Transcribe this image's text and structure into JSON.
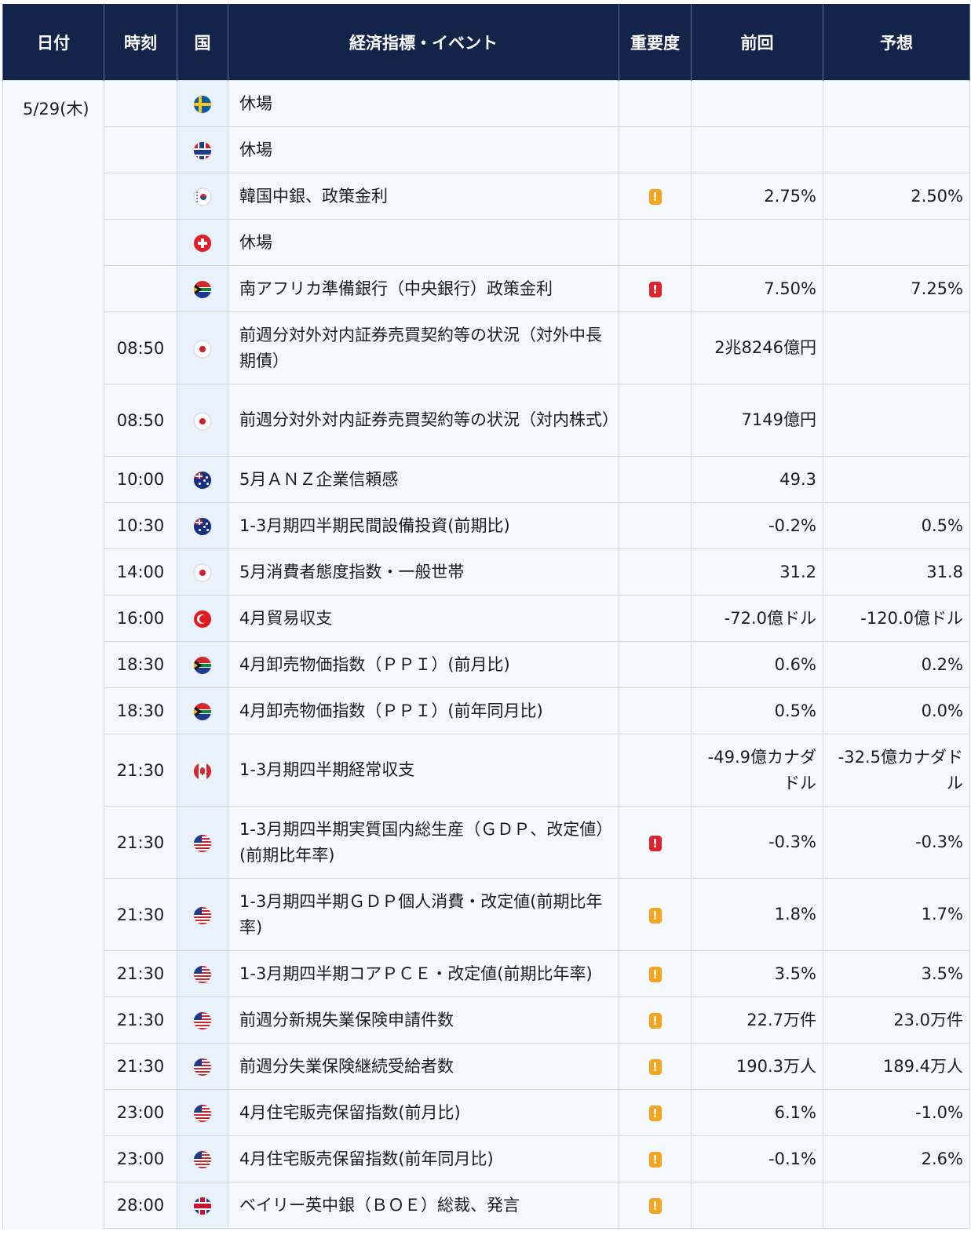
{
  "headers": {
    "date": "日付",
    "time": "時刻",
    "country": "国",
    "event": "経済指標・イベント",
    "importance": "重要度",
    "previous": "前回",
    "forecast": "予想"
  },
  "date": "5/29(木)",
  "rows": [
    {
      "time": "",
      "flag": "sweden-flag-icon",
      "event": "休場",
      "importance": "",
      "previous": "",
      "forecast": ""
    },
    {
      "time": "",
      "flag": "norway-flag-icon",
      "event": "休場",
      "importance": "",
      "previous": "",
      "forecast": ""
    },
    {
      "time": "",
      "flag": "korea-flag-icon",
      "event": "韓国中銀、政策金利",
      "importance": "!",
      "previous": "2.75%",
      "forecast": "2.50%"
    },
    {
      "time": "",
      "flag": "switzerland-flag-icon",
      "event": "休場",
      "importance": "",
      "previous": "",
      "forecast": ""
    },
    {
      "time": "",
      "flag": "south-africa-flag-icon",
      "event": "南アフリカ準備銀行（中央銀行）政策金利",
      "importance": "!",
      "previous": "7.50%",
      "forecast": "7.25%"
    },
    {
      "time": "08:50",
      "flag": "japan-flag-icon",
      "event": "前週分対外対内証券売買契約等の状況（対外中長期債）",
      "importance": "",
      "previous": "2兆8246億円",
      "forecast": ""
    },
    {
      "time": "08:50",
      "flag": "japan-flag-icon",
      "event": "前週分対外対内証券売買契約等の状況（対内株式）",
      "importance": "",
      "previous": "7149億円",
      "forecast": ""
    },
    {
      "time": "10:00",
      "flag": "new-zealand-flag-icon",
      "event": "5月ＡＮＺ企業信頼感",
      "importance": "",
      "previous": "49.3",
      "forecast": ""
    },
    {
      "time": "10:30",
      "flag": "australia-flag-icon",
      "event": "1-3月期四半期民間設備投資(前期比)",
      "importance": "",
      "previous": "-0.2%",
      "forecast": "0.5%"
    },
    {
      "time": "14:00",
      "flag": "japan-flag-icon",
      "event": "5月消費者態度指数・一般世帯",
      "importance": "",
      "previous": "31.2",
      "forecast": "31.8"
    },
    {
      "time": "16:00",
      "flag": "turkey-flag-icon",
      "event": "4月貿易収支",
      "importance": "",
      "previous": "-72.0億ドル",
      "forecast": "-120.0億ドル"
    },
    {
      "time": "18:30",
      "flag": "south-africa-flag-icon",
      "event": "4月卸売物価指数（ＰＰＩ）(前月比)",
      "importance": "",
      "previous": "0.6%",
      "forecast": "0.2%"
    },
    {
      "time": "18:30",
      "flag": "south-africa-flag-icon",
      "event": "4月卸売物価指数（ＰＰＩ）(前年同月比)",
      "importance": "",
      "previous": "0.5%",
      "forecast": "0.0%"
    },
    {
      "time": "21:30",
      "flag": "canada-flag-icon",
      "event": "1-3月期四半期経常収支",
      "importance": "",
      "previous": "-49.9億カナダドル",
      "forecast": "-32.5億カナダドル"
    },
    {
      "time": "21:30",
      "flag": "us-flag-icon",
      "event": "1-3月期四半期実質国内総生産（ＧＤＰ、改定値）(前期比年率)",
      "importance": "!",
      "previous": "-0.3%",
      "forecast": "-0.3%"
    },
    {
      "time": "21:30",
      "flag": "us-flag-icon",
      "event": "1-3月期四半期ＧＤＰ個人消費・改定値(前期比年率)",
      "importance": "!",
      "previous": "1.8%",
      "forecast": "1.7%"
    },
    {
      "time": "21:30",
      "flag": "us-flag-icon",
      "event": "1-3月期四半期コアＰＣＥ・改定値(前期比年率)",
      "importance": "!",
      "previous": "3.5%",
      "forecast": "3.5%"
    },
    {
      "time": "21:30",
      "flag": "us-flag-icon",
      "event": "前週分新規失業保険申請件数",
      "importance": "!",
      "previous": "22.7万件",
      "forecast": "23.0万件"
    },
    {
      "time": "21:30",
      "flag": "us-flag-icon",
      "event": "前週分失業保険継続受給者数",
      "importance": "!",
      "previous": "190.3万人",
      "forecast": "189.4万人"
    },
    {
      "time": "23:00",
      "flag": "us-flag-icon",
      "event": "4月住宅販売保留指数(前月比)",
      "importance": "!",
      "previous": "6.1%",
      "forecast": "-1.0%"
    },
    {
      "time": "23:00",
      "flag": "us-flag-icon",
      "event": "4月住宅販売保留指数(前年同月比)",
      "importance": "!",
      "previous": "-0.1%",
      "forecast": "2.6%"
    },
    {
      "time": "28:00",
      "flag": "uk-flag-icon",
      "event": "ベイリー英中銀（ＢＯＥ）総裁、発言",
      "importance": "!",
      "previous": "",
      "forecast": ""
    }
  ],
  "colors": {
    "header_bg": "#13244a",
    "importance_high": "#e0222f",
    "importance_mid": "#f6a41d",
    "row_bg": "#f6f9fc",
    "flag_col_bg": "#e9f2fb"
  }
}
